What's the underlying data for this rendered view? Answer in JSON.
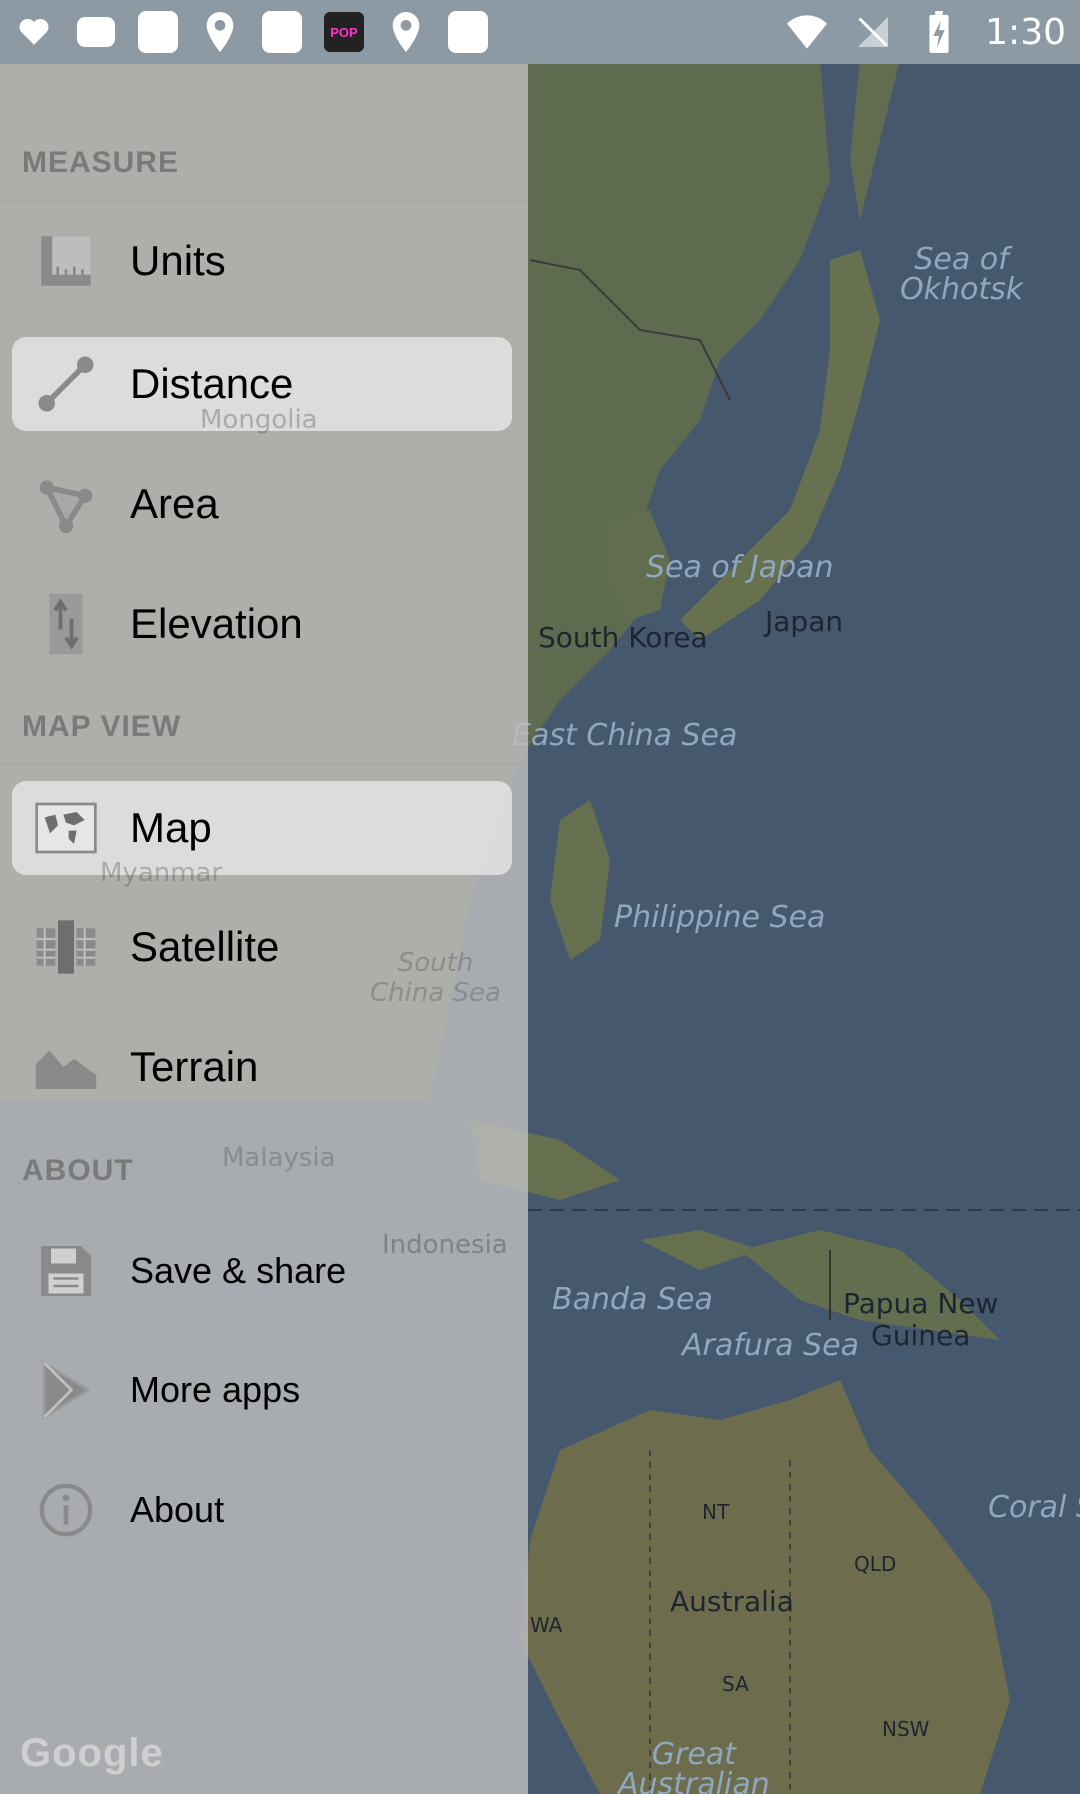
{
  "status_bar": {
    "clock": "1:30",
    "icons": [
      "notification-square-icon",
      "location-pin-icon",
      "notification-square-icon",
      "kpop-app-icon",
      "location-pin-icon",
      "notification-square-icon",
      "wifi-icon",
      "no-sim-icon",
      "battery-charging-icon"
    ],
    "kpop_badge": "POP"
  },
  "map": {
    "labels": {
      "sea_of_okhotsk": "Sea of\nOkhotsk",
      "sea_of_japan": "Sea of Japan",
      "south_korea": "South Korea",
      "japan": "Japan",
      "east_china_sea": "East China Sea",
      "philippine_sea": "Philippine Sea",
      "south_china_sea": "South\nChina Sea",
      "mongolia": "Mongolia",
      "myanmar": "Myanmar",
      "malaysia": "Malaysia",
      "indonesia": "Indonesia",
      "banda_sea": "Banda Sea",
      "arafura_sea": "Arafura Sea",
      "papua_new_guinea": "Papua New\nGuinea",
      "coral_sea": "Coral Se",
      "nt": "NT",
      "qld": "QLD",
      "wa": "WA",
      "australia": "Australia",
      "sa": "SA",
      "nsw": "NSW",
      "great_australian": "Great\nAustralian"
    }
  },
  "drawer": {
    "sections": {
      "measure": "MEASURE",
      "map_view": "MAP VIEW",
      "about": "ABOUT"
    },
    "items": {
      "units": "Units",
      "distance": "Distance",
      "area": "Area",
      "elevation": "Elevation",
      "map": "Map",
      "satellite": "Satellite",
      "terrain": "Terrain",
      "save_share": "Save & share",
      "more_apps": "More apps",
      "about": "About"
    },
    "selected": [
      "distance",
      "map"
    ],
    "google_logo": "Google"
  },
  "colors": {
    "drawer_bg": "#bebebe",
    "selected_bg": "#ebebeb",
    "section_text": "#7a7a7a",
    "sea": "#46586e",
    "land": "#5f6b4f"
  }
}
